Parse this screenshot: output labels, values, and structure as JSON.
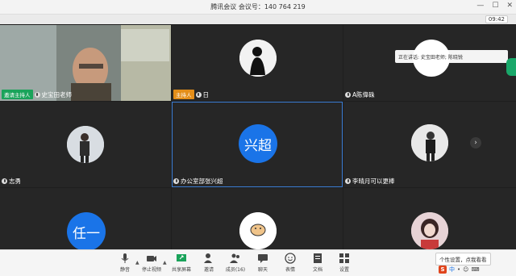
{
  "window": {
    "title": "腾讯会议 会议号：140 764 219",
    "timer": "09:42"
  },
  "tiles": [
    {
      "name": "史宝田老师",
      "badge": "邀请主持人"
    },
    {
      "name": "日",
      "badge": "主持人"
    },
    {
      "name": "A陈偉硃"
    },
    {
      "name": "志勇"
    },
    {
      "name": "办公室部张兴超",
      "avatar_text": "兴超"
    },
    {
      "name": "李晴月可以更棒"
    },
    {
      "name": "",
      "avatar_text": "任一"
    },
    {
      "name": ""
    },
    {
      "name": ""
    }
  ],
  "speaking": {
    "text": "正在讲话: 史宝田老师; 陈晓锐"
  },
  "toolbar": {
    "mute": "静音",
    "stop_video": "停止视频",
    "share_screen": "共享屏幕",
    "invite": "邀请",
    "members": "成员(16)",
    "chat": "聊天",
    "reactions": "表情",
    "docs": "文档",
    "settings": "设置"
  },
  "tooltip": "个性设置，点我看看",
  "ime": {
    "label": "中"
  },
  "colors": {
    "host": "#1aa35a",
    "cohost": "#e48e19",
    "accent": "#1a74e8"
  }
}
